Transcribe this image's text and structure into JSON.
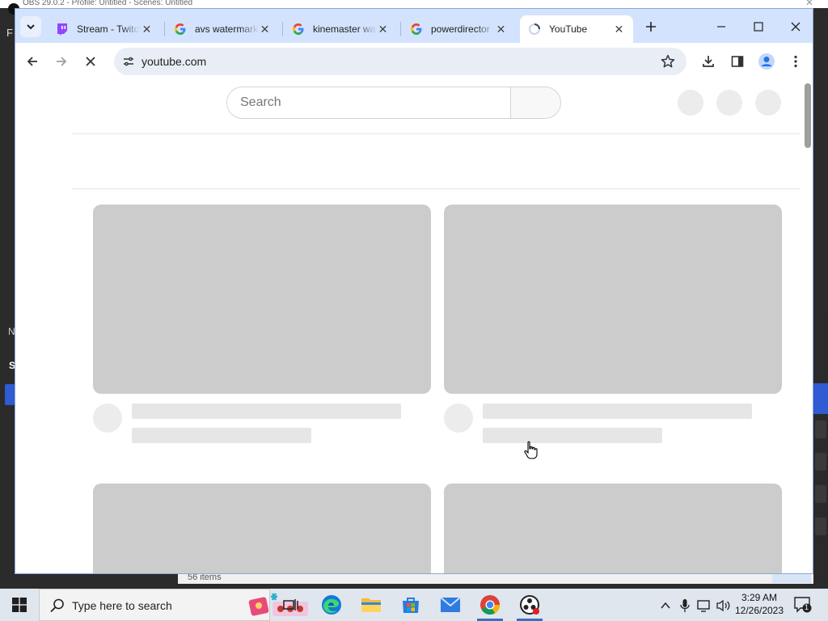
{
  "background_app": {
    "title": "OBS 29.0.2 - Profile: Untitled - Scenes: Untitled",
    "menu_letter": "F",
    "panel_letter_n": "N",
    "panel_letter_s": "S",
    "status_text": "56 items"
  },
  "browser": {
    "tabs": [
      {
        "title": "Stream - Twitch",
        "favicon": "twitch-icon",
        "active": false
      },
      {
        "title": "avs watermark",
        "favicon": "google-icon",
        "active": false
      },
      {
        "title": "kinemaster watermark",
        "favicon": "google-icon",
        "active": false
      },
      {
        "title": "powerdirector",
        "favicon": "google-icon",
        "active": false
      },
      {
        "title": "YouTube",
        "favicon": "loading-icon",
        "active": true
      }
    ],
    "url": "youtube.com",
    "page": {
      "search_placeholder": "Search"
    }
  },
  "taskbar": {
    "search_placeholder": "Type here to search",
    "clock_time": "3:29 AM",
    "clock_date": "12/26/2023",
    "notification_count": "1",
    "apps": [
      "task-view-icon",
      "edge-icon",
      "file-explorer-icon",
      "microsoft-store-icon",
      "mail-icon",
      "chrome-icon",
      "obs-icon"
    ]
  },
  "colors": {
    "tabstrip": "#d3e3fd",
    "skeleton": "#cccccc",
    "taskbar": "#dfe6ee",
    "accent": "#1a73e8"
  }
}
